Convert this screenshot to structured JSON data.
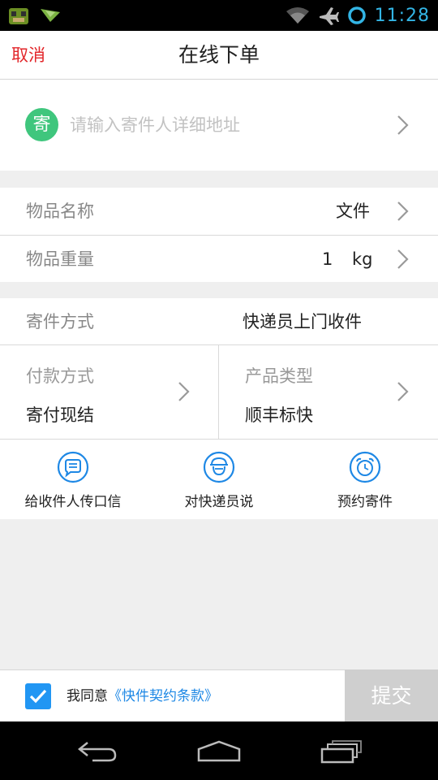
{
  "status_bar": {
    "time": "11:28",
    "icons": [
      "app-notification-icon",
      "download-notification-icon",
      "wifi-icon",
      "airplane-icon",
      "sync-circle-icon"
    ],
    "accent_color": "#33b5e5"
  },
  "header": {
    "cancel_label": "取消",
    "title": "在线下单"
  },
  "sender": {
    "badge": "寄",
    "placeholder": "请输入寄件人详细地址"
  },
  "item": {
    "name_label": "物品名称",
    "name_value": "文件",
    "weight_label": "物品重量",
    "weight_value": "1",
    "weight_unit": "kg"
  },
  "shipping": {
    "method_label": "寄件方式",
    "method_value": "快递员上门收件",
    "payment_label": "付款方式",
    "payment_value": "寄付现结",
    "product_label": "产品类型",
    "product_value": "顺丰标快"
  },
  "actions": [
    {
      "label": "给收件人传口信",
      "icon": "message-icon"
    },
    {
      "label": "对快递员说",
      "icon": "courier-icon"
    },
    {
      "label": "预约寄件",
      "icon": "alarm-clock-icon"
    }
  ],
  "footer": {
    "agree_prefix": "我同意",
    "agree_link": "《快件契约条款》",
    "checked": true,
    "submit_label": "提交"
  },
  "colors": {
    "cancel": "#e2262a",
    "badge": "#3fc67d",
    "link": "#1e88e5",
    "checkbox": "#2196f3",
    "submit_disabled": "#cfcfcf"
  }
}
